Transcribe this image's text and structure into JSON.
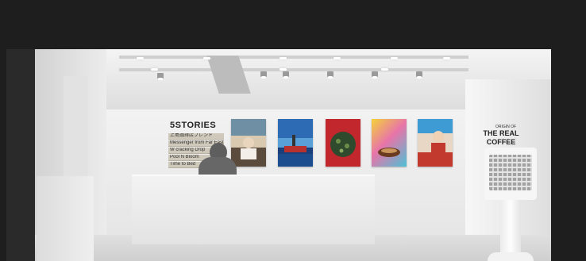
{
  "store": {
    "brand": "5STORIES",
    "menu": [
      "上島珈琲店ブレンド",
      "Messenger from Far East",
      "W cracking Drop",
      "Pool N Bloom",
      "Time to Bed"
    ]
  },
  "right_wall": {
    "small_text": "ORIGIN OF",
    "headline_1": "THE REAL",
    "headline_2": "COFFEE"
  },
  "colors": {
    "wall": "#eeeeee",
    "frame_background": "#1e1e1e",
    "menu_bar": "#cfc9bc"
  }
}
